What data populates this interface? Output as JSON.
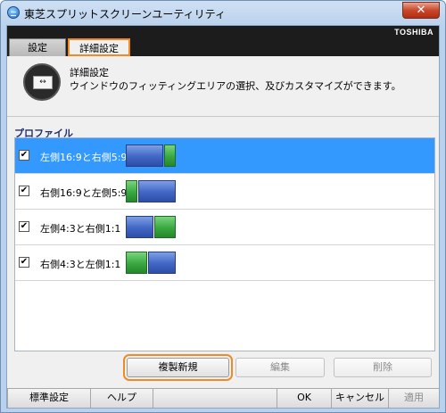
{
  "window": {
    "title": "東芝スプリットスクリーンユーティリティ",
    "close_glyph": "✕"
  },
  "brand": "TOSHIBA",
  "tabs": [
    {
      "label": "設定",
      "active": false
    },
    {
      "label": "詳細設定",
      "active": true
    }
  ],
  "header": {
    "icon_glyph": "↔",
    "title": "詳細設定",
    "description": "ウインドウのフィッティングエリアの選択、及びカスタマイズができます。"
  },
  "profiles": {
    "section_label": "プロファイル",
    "items": [
      {
        "label": "左側16:9と右側5:9",
        "checked": true,
        "selected": true,
        "blocks": [
          "blue-wide",
          "green-narrow"
        ]
      },
      {
        "label": "右側16:9と左側5:9",
        "checked": true,
        "selected": false,
        "blocks": [
          "green-narrow",
          "blue-wide"
        ]
      },
      {
        "label": "左側4:3と右側1:1",
        "checked": true,
        "selected": false,
        "blocks": [
          "blue-mid",
          "green-mid"
        ]
      },
      {
        "label": "右側4:3と左側1:1",
        "checked": true,
        "selected": false,
        "blocks": [
          "green-mid",
          "blue-mid"
        ]
      }
    ]
  },
  "actions": {
    "duplicate_label": "複製新規",
    "edit_label": "編集",
    "delete_label": "削除"
  },
  "bottom": {
    "default_label": "標準設定",
    "help_label": "ヘルプ",
    "ok_label": "OK",
    "cancel_label": "キャンセル",
    "apply_label": "適用"
  },
  "colors": {
    "accent_highlight": "#f08a24",
    "selection": "#3399ff",
    "block_blue": "#4166c4",
    "block_green": "#38a840"
  }
}
